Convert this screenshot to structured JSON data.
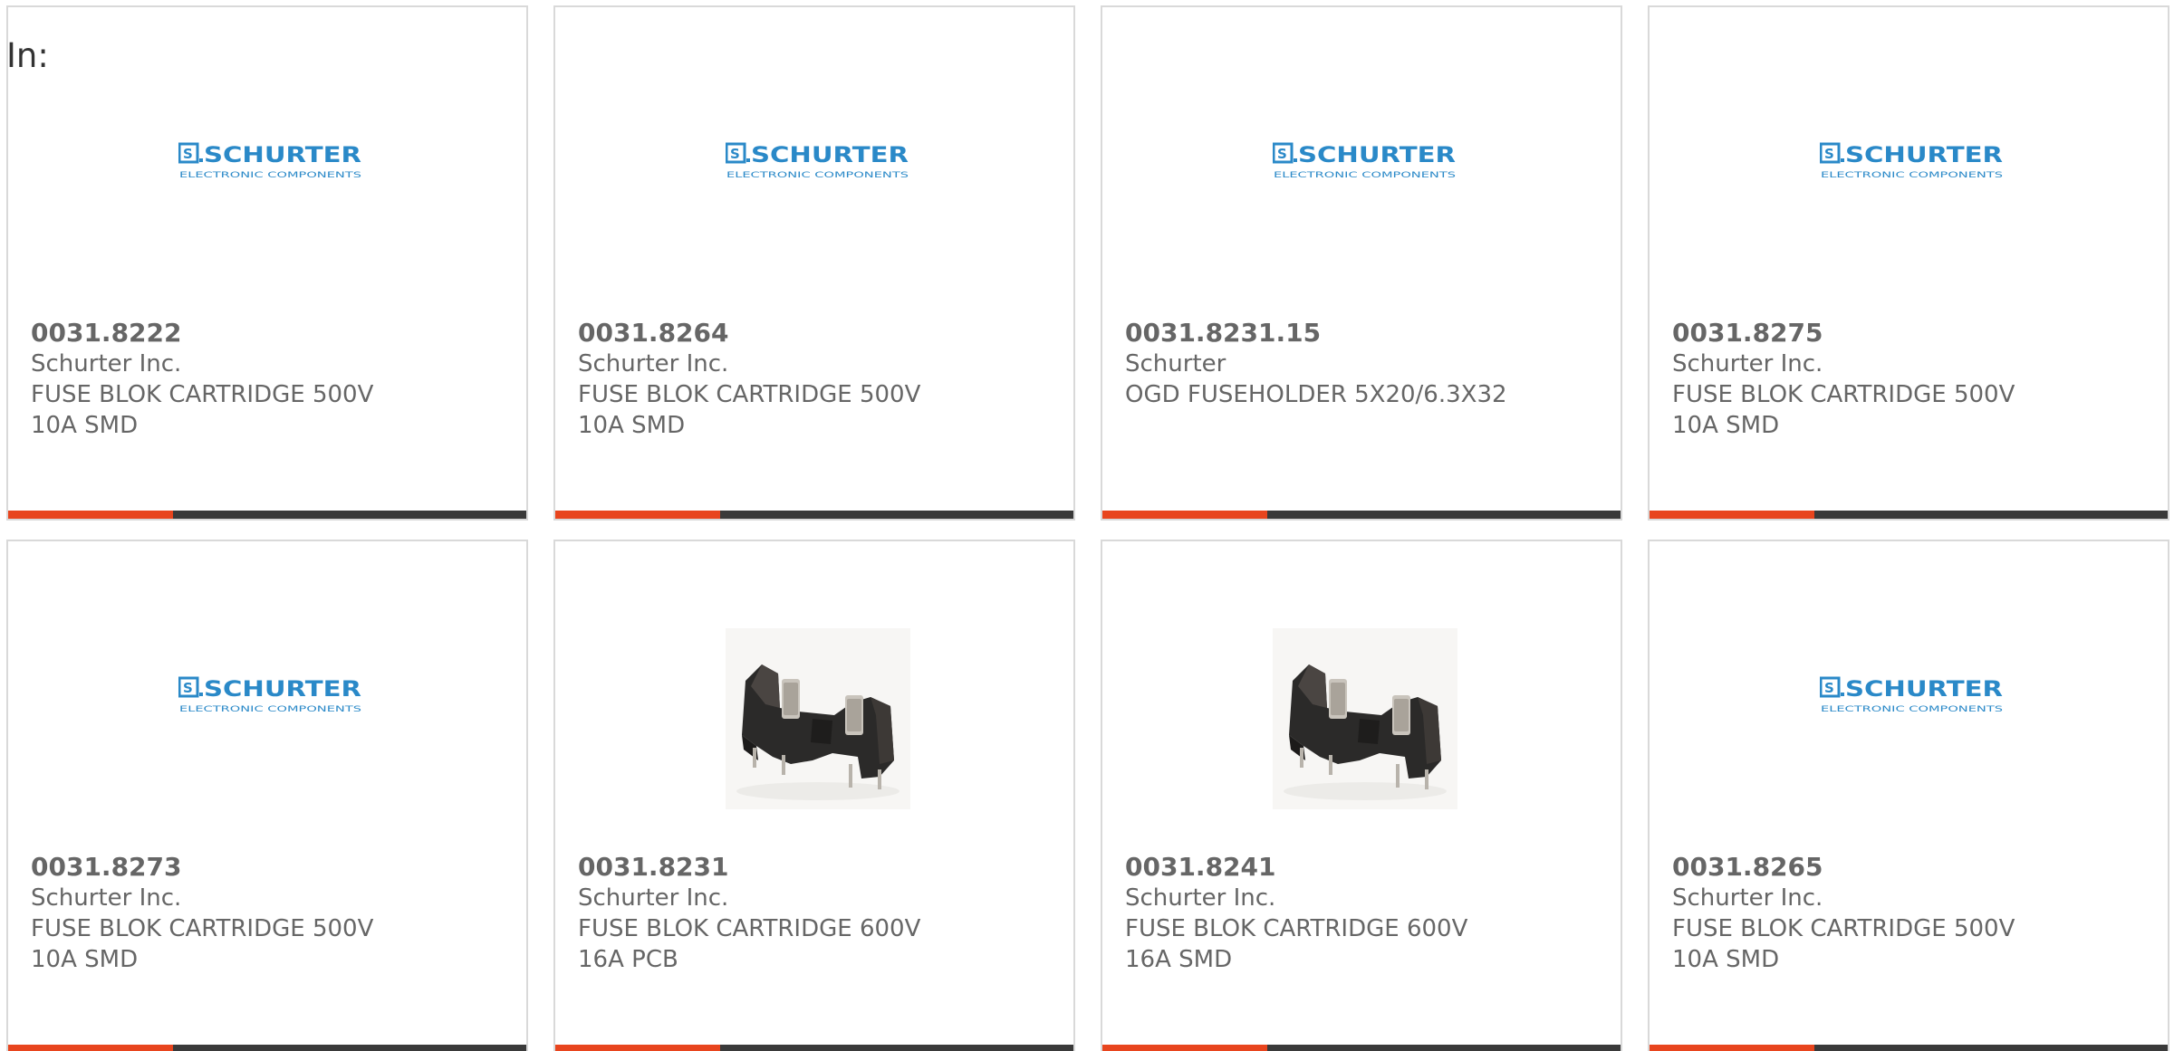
{
  "header": {
    "in_label": "In:"
  },
  "colors": {
    "accent": "#e8451e",
    "bar": "#3a3a3a",
    "brand_blue": "#2a89c8",
    "text": "#666666"
  },
  "products": [
    {
      "part_number": "0031.8222",
      "manufacturer": "Schurter Inc.",
      "description_line1": "FUSE BLOK CARTRIDGE 500V",
      "description_line2": "10A SMD",
      "image": "schurter-logo"
    },
    {
      "part_number": "0031.8264",
      "manufacturer": "Schurter Inc.",
      "description_line1": "FUSE BLOK CARTRIDGE 500V",
      "description_line2": "10A SMD",
      "image": "schurter-logo"
    },
    {
      "part_number": "0031.8231.15",
      "manufacturer": "Schurter",
      "description_line1": "OGD FUSEHOLDER 5X20/6.3X32",
      "description_line2": "",
      "image": "schurter-logo"
    },
    {
      "part_number": "0031.8275",
      "manufacturer": "Schurter Inc.",
      "description_line1": "FUSE BLOK CARTRIDGE 500V",
      "description_line2": "10A SMD",
      "image": "schurter-logo"
    },
    {
      "part_number": "0031.8273",
      "manufacturer": "Schurter Inc.",
      "description_line1": "FUSE BLOK CARTRIDGE 500V",
      "description_line2": "10A SMD",
      "image": "schurter-logo"
    },
    {
      "part_number": "0031.8231",
      "manufacturer": "Schurter Inc.",
      "description_line1": "FUSE BLOK CARTRIDGE 600V",
      "description_line2": "16A PCB",
      "image": "fuse-holder-photo"
    },
    {
      "part_number": "0031.8241",
      "manufacturer": "Schurter Inc.",
      "description_line1": "FUSE BLOK CARTRIDGE 600V",
      "description_line2": "16A SMD",
      "image": "fuse-holder-photo"
    },
    {
      "part_number": "0031.8265",
      "manufacturer": "Schurter Inc.",
      "description_line1": "FUSE BLOK CARTRIDGE 500V",
      "description_line2": "10A SMD",
      "image": "schurter-logo"
    }
  ]
}
